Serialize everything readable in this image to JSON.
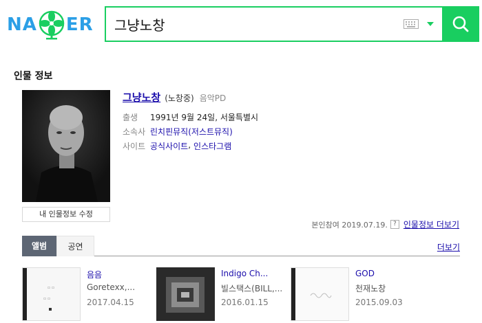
{
  "logo": {
    "left_text": "NA",
    "right_text": "ER"
  },
  "search": {
    "query": "그냥노창"
  },
  "section": {
    "title": "인물 정보"
  },
  "profile": {
    "name": "그냥노창",
    "alias": "(노창중)",
    "occupation": "음악PD",
    "birth_label": "출생",
    "birth_value": "1991년 9월 24일, 서울특별시",
    "agency_label": "소속사",
    "agency_value": "린치핀뮤직(저스트뮤직)",
    "site_label": "사이트",
    "site_link1": "공식사이트",
    "site_sep": ",",
    "site_link2": "인스타그램",
    "edit_button": "내 인물정보 수정"
  },
  "reference": {
    "text": "본인참여 2019.07.19.",
    "help": "?",
    "more_link": "인물정보 더보기"
  },
  "tabs": {
    "album": "앨범",
    "show": "공연",
    "more": "더보기"
  },
  "albums": [
    {
      "title": "음음",
      "artist": "Goretexx,...",
      "date": "2017.04.15"
    },
    {
      "title": "Indigo Ch...",
      "artist": "빌스택스(BILL,...",
      "date": "2016.01.15"
    },
    {
      "title": "GOD",
      "artist": "천재노창",
      "date": "2015.09.03"
    }
  ],
  "colors": {
    "brand_green": "#19ce60",
    "logo_blue": "#2b9fe6",
    "link": "#1a0dab",
    "tab_active": "#5d6674"
  }
}
